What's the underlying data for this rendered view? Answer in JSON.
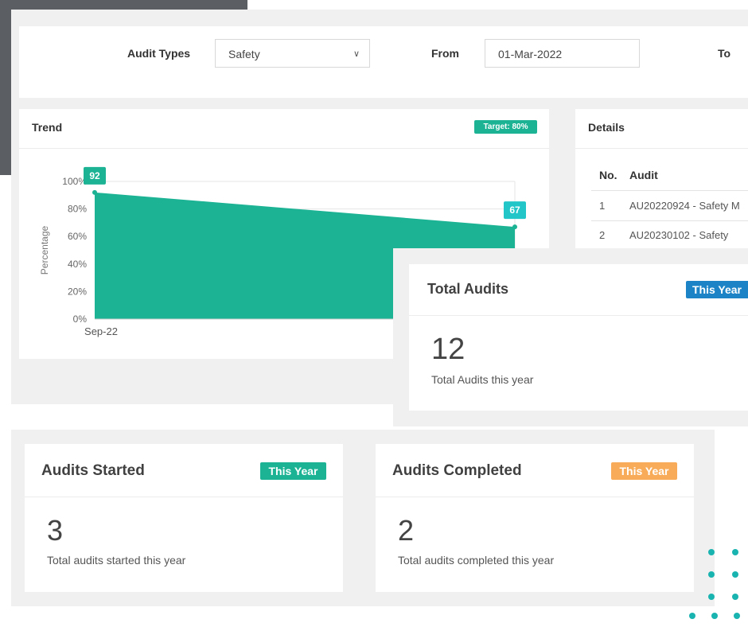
{
  "filter": {
    "audit_types_label": "Audit Types",
    "audit_types_value": "Safety",
    "from_label": "From",
    "from_value": "01-Mar-2022",
    "to_label": "To"
  },
  "trend": {
    "title": "Trend",
    "target_badge": "Target: 80%"
  },
  "details": {
    "title": "Details",
    "col_no": "No.",
    "col_audit": "Audit",
    "rows": [
      {
        "no": "1",
        "audit": "AU20220924 - Safety M"
      },
      {
        "no": "2",
        "audit": "AU20230102 - Safety"
      }
    ]
  },
  "total_audits": {
    "title": "Total Audits",
    "badge": "This Year",
    "value": "12",
    "caption": "Total Audits this year"
  },
  "audits_started": {
    "title": "Audits Started",
    "badge": "This Year",
    "value": "3",
    "caption": "Total audits started this year"
  },
  "audits_completed": {
    "title": "Audits Completed",
    "badge": "This Year",
    "value": "2",
    "caption": "Total audits completed this year"
  },
  "colors": {
    "teal": "#1bb394",
    "cyan_label": "#23c6c8",
    "blue_badge": "#1c84c6",
    "orange_badge": "#f8ac59",
    "dots": "#19b3b0"
  },
  "chart_data": {
    "type": "area",
    "categories": [
      "Sep-22",
      ""
    ],
    "values": [
      92,
      67
    ],
    "data_labels": [
      "92",
      "67"
    ],
    "ylabel": "Percentage",
    "ylim": [
      0,
      100
    ],
    "yticks": [
      "0%",
      "20%",
      "40%",
      "60%",
      "80%",
      "100%"
    ],
    "grid": true,
    "legend": "none"
  }
}
